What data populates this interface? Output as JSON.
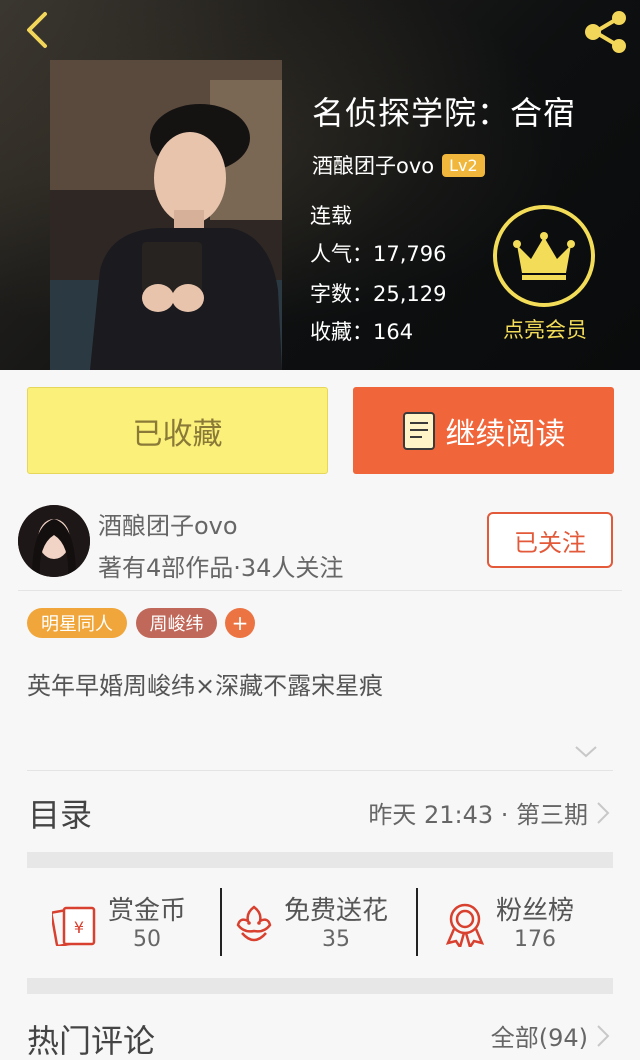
{
  "header": {
    "back_icon": "chevron-left-icon",
    "share_icon": "share-icon"
  },
  "book": {
    "title": "名侦探学院：合宿",
    "author": "酒酿团子ovo",
    "level": "Lv2",
    "status": "连载",
    "popularity": "人气：17,796",
    "word_count": "字数：25,129",
    "favorites": "收藏：164"
  },
  "vip": {
    "label": "点亮会员",
    "icon": "crown-icon"
  },
  "actions": {
    "collected_label": "已收藏",
    "read_label": "继续阅读"
  },
  "author_panel": {
    "name": "酒酿团子ovo",
    "meta": "著有4部作品·34人关注",
    "follow_label": "已关注"
  },
  "tags": [
    {
      "label": "明星同人"
    },
    {
      "label": "周峻纬"
    }
  ],
  "tag_add": "+",
  "description": "英年早婚周峻纬×深藏不露宋星痕",
  "toc": {
    "title": "目录",
    "latest": "昨天 21:43 · 第三期"
  },
  "stats": [
    {
      "label": "赏金币",
      "value": "50",
      "icon": "red-envelope-icon"
    },
    {
      "label": "免费送花",
      "value": "35",
      "icon": "flower-icon"
    },
    {
      "label": "粉丝榜",
      "value": "176",
      "icon": "rosette-icon"
    }
  ],
  "comments": {
    "title": "热门评论",
    "all_label": "全部(94)"
  },
  "colors": {
    "accent": "#f0653a",
    "collected_bg": "#fbf07a",
    "gold": "#f2dc58",
    "tag_star": "#f0a63a",
    "tag_person": "#c0685a"
  }
}
